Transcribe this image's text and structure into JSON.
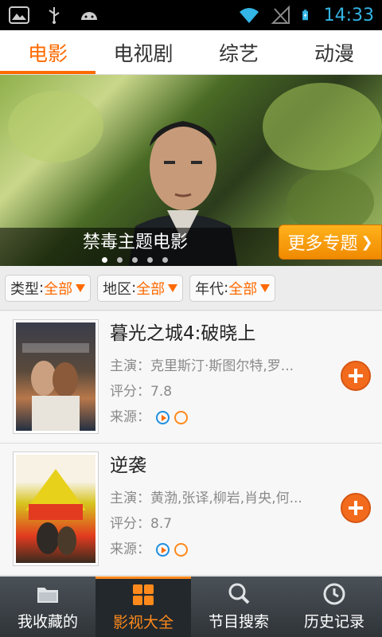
{
  "status_bar": {
    "time": "14:33"
  },
  "tabs": [
    {
      "label": "电影",
      "active": true
    },
    {
      "label": "电视剧",
      "active": false
    },
    {
      "label": "综艺",
      "active": false
    },
    {
      "label": "动漫",
      "active": false
    }
  ],
  "banner": {
    "title": "禁毒主题电影",
    "more_label": "更多专题",
    "more_chevron": "❯",
    "dots_total": 5,
    "dots_active": 1
  },
  "filters": [
    {
      "label": "类型",
      "value": "全部"
    },
    {
      "label": "地区",
      "value": "全部"
    },
    {
      "label": "年代",
      "value": "全部"
    }
  ],
  "movies": [
    {
      "title": "暮光之城4:破晓上",
      "cast_label": "主演：",
      "cast": "克里斯汀·斯图尔特,罗...",
      "rating_label": "评分：",
      "rating": "7.8",
      "source_label": "来源："
    },
    {
      "title": "逆袭",
      "cast_label": "主演：",
      "cast": "黄渤,张译,柳岩,肖央,何...",
      "rating_label": "评分：",
      "rating": "8.7",
      "source_label": "来源："
    }
  ],
  "bottom_nav": [
    {
      "label": "我收藏的",
      "icon": "folder-icon",
      "active": false
    },
    {
      "label": "影视大全",
      "icon": "grid-icon",
      "active": true
    },
    {
      "label": "节目搜索",
      "icon": "search-icon",
      "active": false
    },
    {
      "label": "历史记录",
      "icon": "clock-icon",
      "active": false
    }
  ]
}
